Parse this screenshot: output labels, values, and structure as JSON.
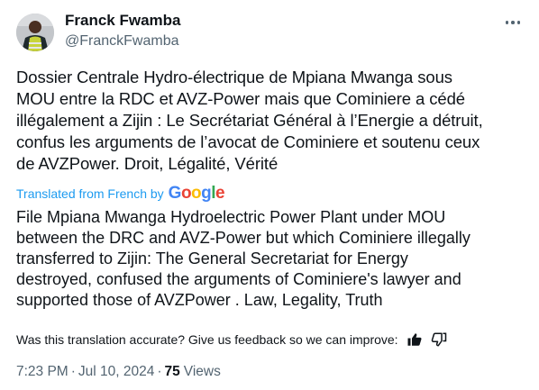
{
  "author": {
    "name": "Franck Fwamba",
    "handle": "@FranckFwamba"
  },
  "tweet": {
    "original_text": "Dossier Centrale Hydro-électrique de Mpiana Mwanga sous\nMOU entre la RDC et AVZ-Power mais que Cominiere a cédé\nillégalement a Zijin : Le Secrétariat Général à l’Energie a détruit,\nconfus les arguments de l’avocat de Cominiere et soutenu ceux\nde AVZPower. Droit, Légalité, Vérité",
    "translated_label": "Translated from French by",
    "translator_brand": [
      "G",
      "o",
      "o",
      "g",
      "l",
      "e"
    ],
    "translator_brand_colors": [
      "#4285f4",
      "#ea4335",
      "#fbbc05",
      "#4285f4",
      "#34a853",
      "#ea4335"
    ],
    "translated_text": "File Mpiana Mwanga Hydroelectric Power Plant under MOU\nbetween the DRC and AVZ-Power but which Cominiere illegally\ntransferred to Zijin: The General Secretariat for Energy\ndestroyed, confused the arguments of Cominiere's lawyer and\nsupported those of AVZPower . Law, Legality, Truth"
  },
  "feedback": {
    "question": "Was this translation accurate? Give us feedback so we can improve:",
    "icons": [
      "thumbs-up-icon",
      "thumbs-down-icon"
    ]
  },
  "meta": {
    "time": "7:23 PM",
    "separator": "·",
    "date": "Jul 10, 2024",
    "views_count": "75",
    "views_label": "Views"
  },
  "colors": {
    "text_primary": "#0f1419",
    "text_secondary": "#536471",
    "link_blue": "#1d9bf0"
  }
}
